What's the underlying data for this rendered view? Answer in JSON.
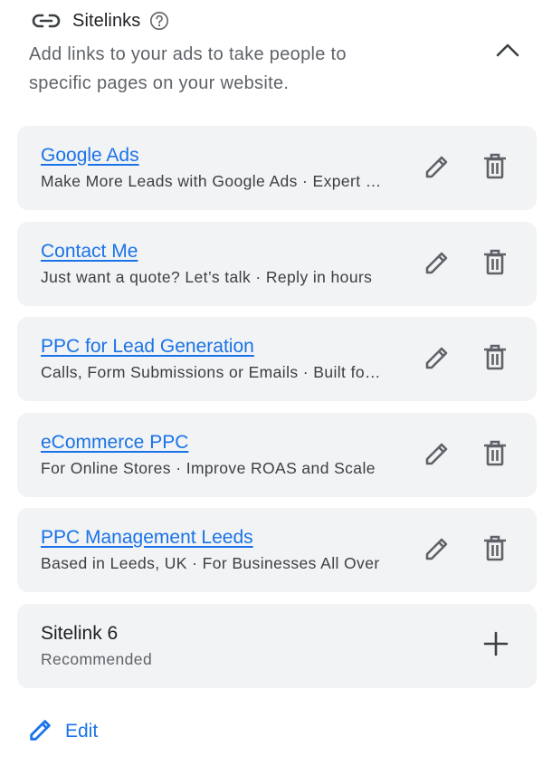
{
  "section": {
    "title": "Sitelinks",
    "icon": "link-icon",
    "help_icon": "help-circle-icon",
    "description": "Add links to your ads to take people to specific pages on your website.",
    "collapse_icon": "chevron-up-icon"
  },
  "sitelinks": [
    {
      "title": "Google Ads",
      "subtitle": "Make More Leads with Google Ads · Expert Google Ads Management"
    },
    {
      "title": "Contact Me",
      "subtitle": "Just want a quote? Let’s talk · Reply in hours"
    },
    {
      "title": "PPC for Lead Generation",
      "subtitle": "Calls, Form Submissions or Emails · Built for growth"
    },
    {
      "title": "eCommerce PPC",
      "subtitle": "For Online Stores · Improve ROAS and Scale"
    },
    {
      "title": "PPC Management Leeds",
      "subtitle": "Based in Leeds, UK · For Businesses All Over"
    }
  ],
  "add_sitelink": {
    "name": "Sitelink 6",
    "badge": "Recommended",
    "icon": "plus-icon"
  },
  "footer": {
    "edit_label": "Edit",
    "edit_icon": "pencil-icon"
  },
  "colors": {
    "accent": "#1a73e8",
    "card_background": "#f1f3f4",
    "icon": "#5f6368"
  }
}
